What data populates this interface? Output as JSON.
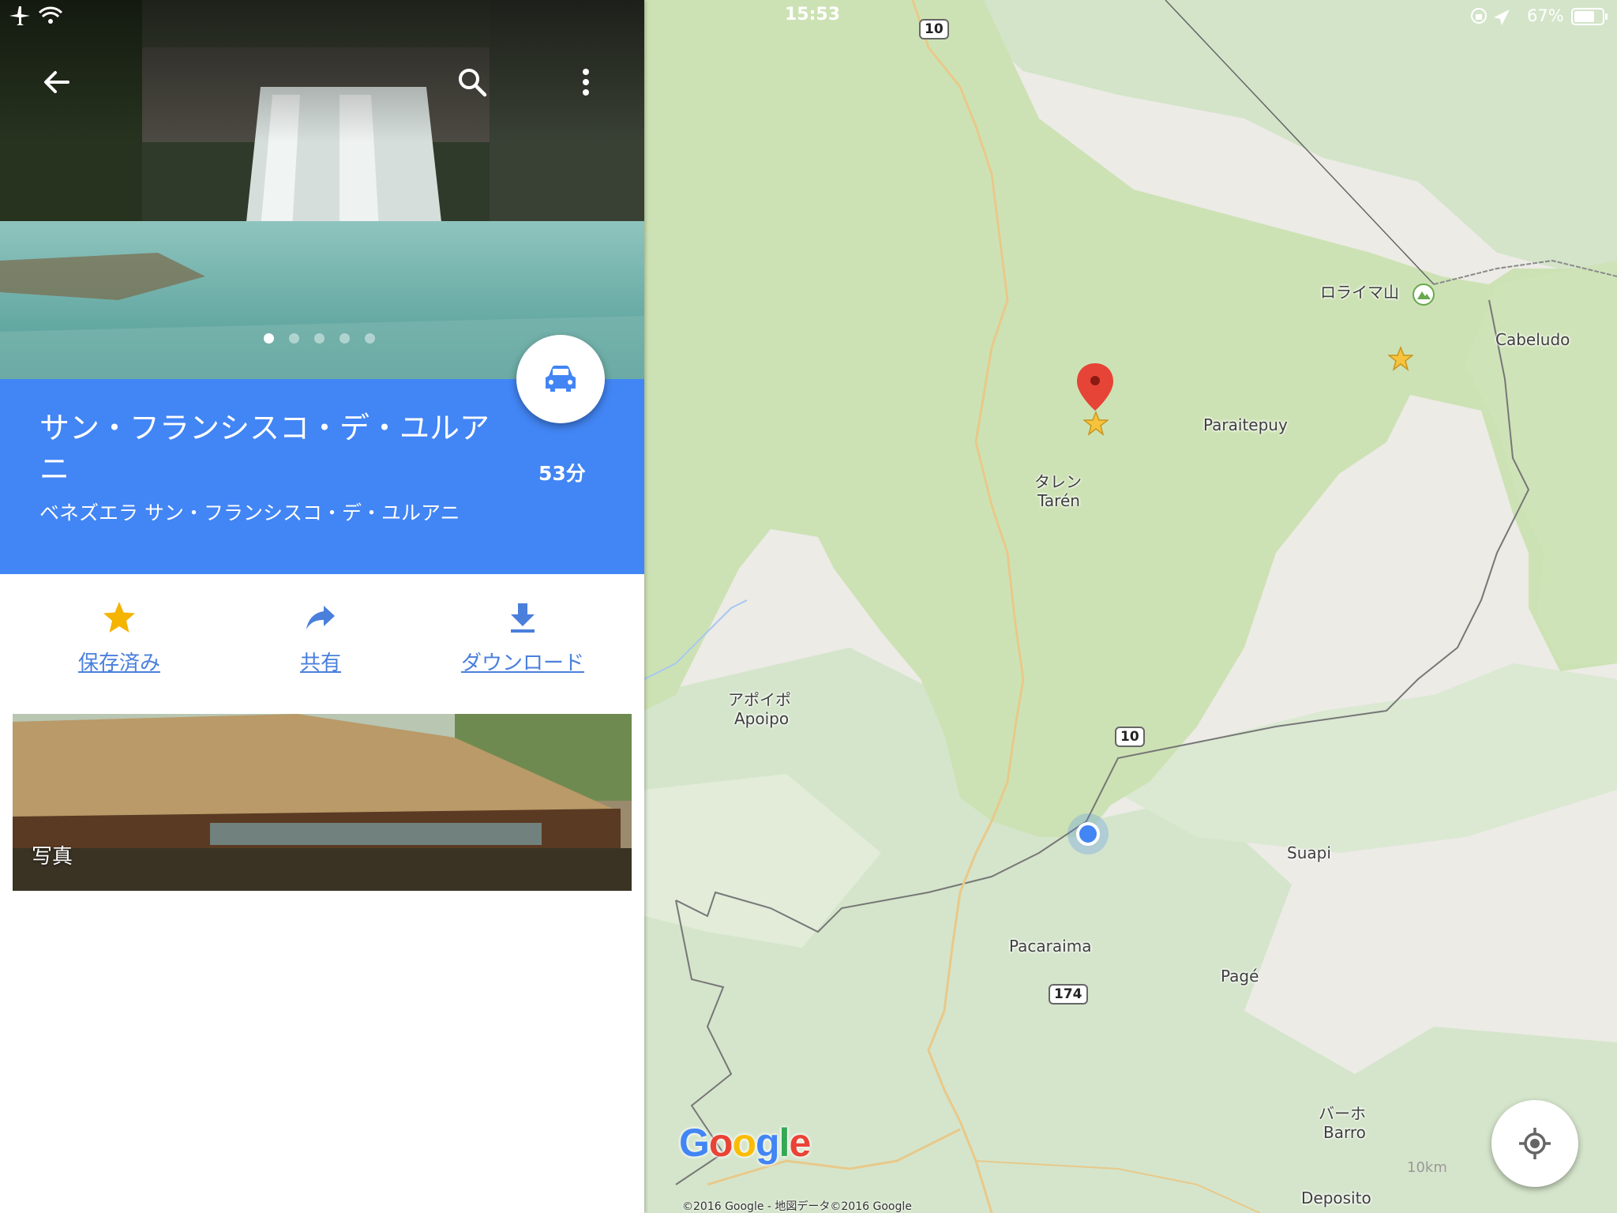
{
  "status_bar": {
    "time": "15:53",
    "battery_text": "67%"
  },
  "place": {
    "title": "サン・フランシスコ・デ・ユルアニ",
    "subtitle": "ベネズエラ サン・フランシスコ・デ・ユルアニ",
    "drive_time": "53分"
  },
  "actions": {
    "saved": "保存済み",
    "share": "共有",
    "download": "ダウンロード"
  },
  "photos": {
    "label": "写真"
  },
  "map": {
    "labels": {
      "roraima": "ロライマ山",
      "cabeludo": "Cabeludo",
      "paraitepuy": "Paraitepuy",
      "taren_ja": "タレン",
      "taren": "Tarén",
      "apoipo_ja": "アポイポ",
      "apoipo": "Apoipo",
      "suapi": "Suapi",
      "pacaraima": "Pacaraima",
      "page": "Pagé",
      "barro_ja": "バーホ",
      "barro": "Barro",
      "deposito": "Deposito"
    },
    "shields": {
      "route_10_top": "10",
      "route_10_mid": "10",
      "route_174": "174"
    },
    "scale": "10km",
    "copyright": "©2016 Google - 地図データ©2016 Google",
    "logo": [
      "G",
      "o",
      "o",
      "g",
      "l",
      "e"
    ],
    "logo_colors": [
      "#4285f4",
      "#ea4335",
      "#fbbc05",
      "#4285f4",
      "#34a853",
      "#ea4335"
    ]
  }
}
